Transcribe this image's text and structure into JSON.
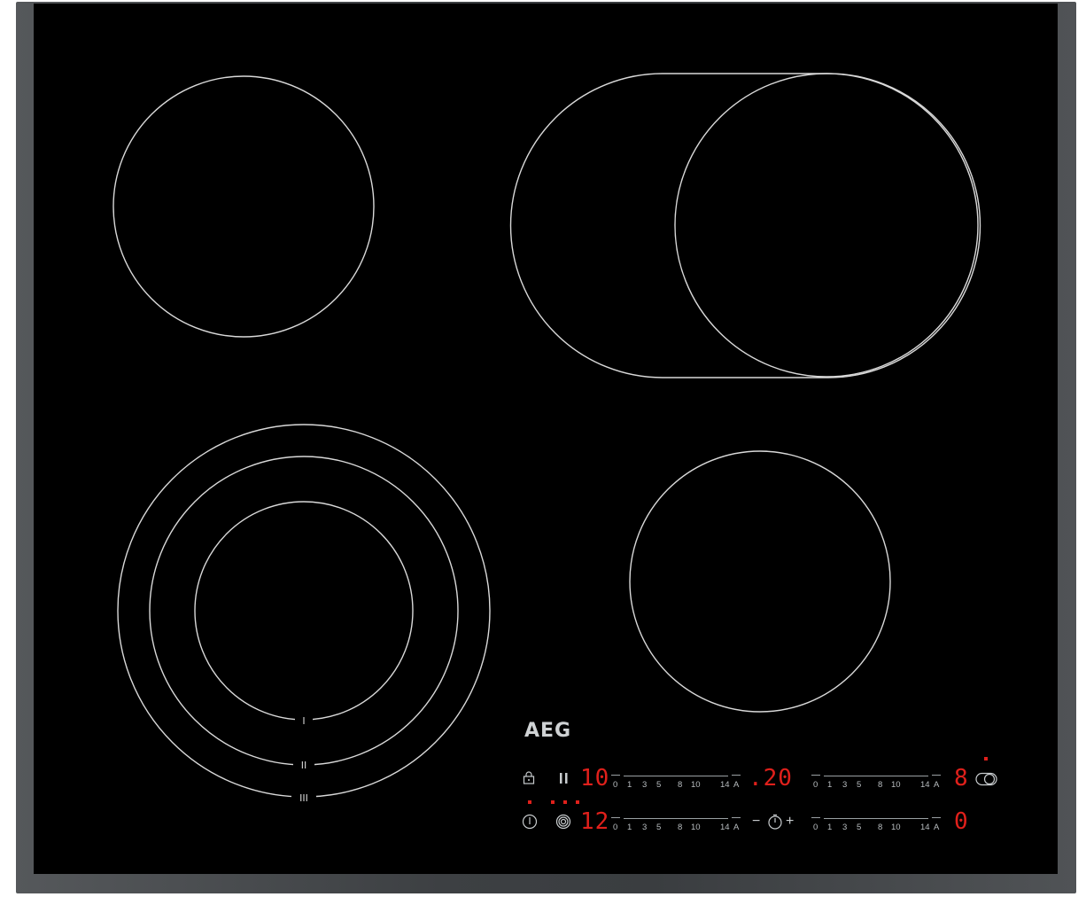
{
  "brand": {
    "logo_text": "AEG"
  },
  "colors": {
    "glass": "#000000",
    "frame": "#45484b",
    "line": "#d9d9d9",
    "display": "#e0201b",
    "text": "#c8ccce"
  },
  "zones": [
    {
      "name": "rear-left-zone",
      "type": "single"
    },
    {
      "name": "rear-right-zone",
      "type": "oval-extended"
    },
    {
      "name": "front-left-zone",
      "type": "triple-ring",
      "ring_labels": [
        "I",
        "II",
        "III"
      ]
    },
    {
      "name": "front-right-zone",
      "type": "single"
    }
  ],
  "controls": {
    "lock_icon": "lock-icon",
    "pause_icon": "pause-icon",
    "power_icon": "power-icon",
    "ring_select_icon": "ring-select-icon",
    "bridge_icon": "oval-zone-icon",
    "timer_icon": "timer-icon",
    "timer_minus": "−",
    "timer_plus": "+",
    "displays": {
      "rear_left": "10",
      "front_left": "12",
      "timer": ".20",
      "rear_right": "8",
      "front_right": "0"
    },
    "slider_scale": [
      "0",
      "1",
      "3",
      "5",
      "8",
      "10",
      "14",
      "A"
    ]
  }
}
